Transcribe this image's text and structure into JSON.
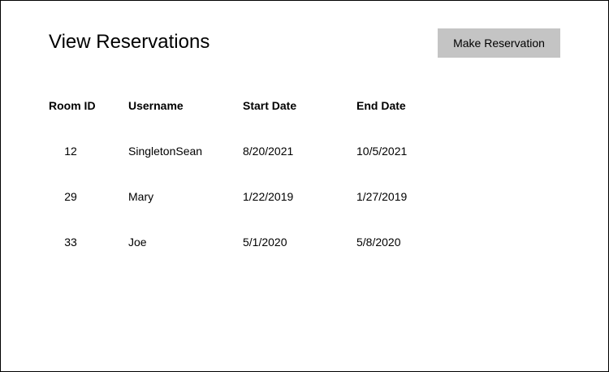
{
  "page": {
    "title": "View Reservations",
    "make_reservation_label": "Make Reservation",
    "button_color": "#c4c4c4"
  },
  "table": {
    "columns": [
      "Room ID",
      "Username",
      "Start Date",
      "End Date"
    ],
    "rows": [
      {
        "room_id": "12",
        "username": "SingletonSean",
        "start_date": "8/20/2021",
        "end_date": "10/5/2021"
      },
      {
        "room_id": "29",
        "username": "Mary",
        "start_date": "1/22/2019",
        "end_date": "1/27/2019"
      },
      {
        "room_id": "33",
        "username": "Joe",
        "start_date": "5/1/2020",
        "end_date": "5/8/2020"
      }
    ]
  }
}
